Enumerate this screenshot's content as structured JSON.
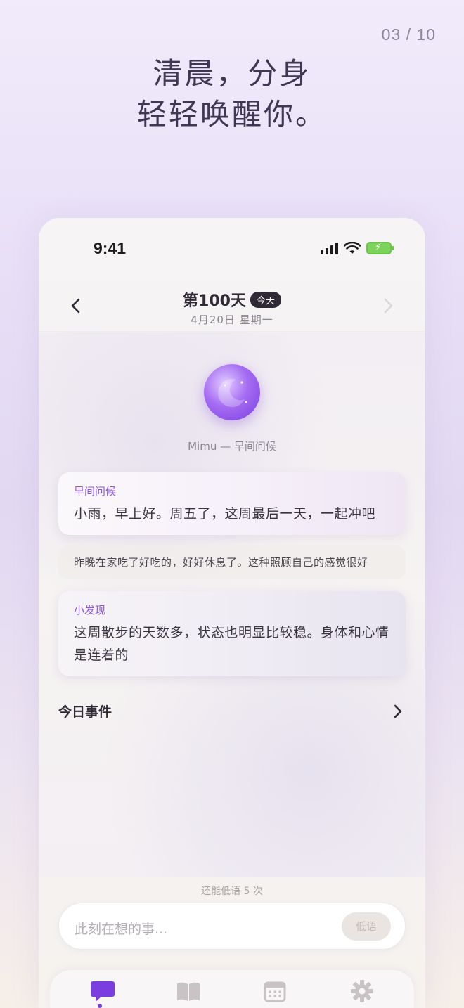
{
  "page_counter": "03 / 10",
  "headline": {
    "line1": "清晨，分身",
    "line2": "轻轻唤醒你。"
  },
  "status_bar": {
    "time": "9:41"
  },
  "header": {
    "title": "第100天",
    "badge": "今天",
    "subtitle": "4月20日 星期一"
  },
  "companion": {
    "caption": "Mimu — 早间问候"
  },
  "cards": [
    {
      "label": "早间问候",
      "text": "小雨，早上好。周五了，这周最后一天，一起冲吧"
    },
    {
      "text": "昨晚在家吃了好吃的，好好休息了。这种照顾自己的感觉很好"
    },
    {
      "label": "小发现",
      "text": "这周散步的天数多，状态也明显比较稳。身体和心情是连着的"
    }
  ],
  "events": {
    "title": "今日事件"
  },
  "composer": {
    "quota": "还能低语 5 次",
    "placeholder": "此刻在想的事...",
    "send_label": "低语"
  },
  "tabs": [
    {
      "name": "chat-icon",
      "active": true
    },
    {
      "name": "book-icon",
      "active": false
    },
    {
      "name": "calendar-icon",
      "active": false
    },
    {
      "name": "gear-icon",
      "active": false
    }
  ],
  "colors": {
    "accent": "#7a3ee0",
    "badge_bg": "#2f2a36",
    "label_purple": "#8a55e0"
  }
}
